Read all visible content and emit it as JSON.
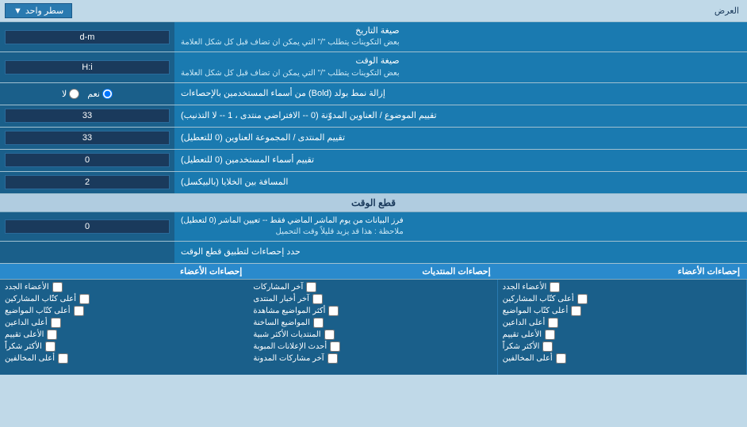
{
  "top": {
    "label": "العرض",
    "dropdown_label": "سطر واحد"
  },
  "rows": [
    {
      "id": "date_format",
      "label": "صيغة التاريخ",
      "sublabel": "بعض التكوينات يتطلب \"/\" التي يمكن ان تضاف قبل كل شكل العلامة",
      "value": "d-m",
      "type": "text"
    },
    {
      "id": "time_format",
      "label": "صيغة الوقت",
      "sublabel": "بعض التكوينات يتطلب \"/\" التي يمكن ان تضاف قبل كل شكل العلامة",
      "value": "H:i",
      "type": "text"
    },
    {
      "id": "bold_names",
      "label": "إزالة نمط بولد (Bold) من أسماء المستخدمين بالإحصاءات",
      "type": "radio",
      "options": [
        "نعم",
        "لا"
      ],
      "selected": "نعم"
    },
    {
      "id": "topic_headings",
      "label": "تقييم الموضوع / العناوين المدوّنة (0 -- الافتراضي منتدى ، 1 -- لا التذنيب)",
      "value": "33",
      "type": "text"
    },
    {
      "id": "forum_headings",
      "label": "تقييم المنتدى / المجموعة العناوين (0 للتعطيل)",
      "value": "33",
      "type": "text"
    },
    {
      "id": "usernames",
      "label": "تقييم أسماء المستخدمين (0 للتعطيل)",
      "value": "0",
      "type": "text"
    },
    {
      "id": "cell_spacing",
      "label": "المسافة بين الخلايا (بالبيكسل)",
      "value": "2",
      "type": "text"
    }
  ],
  "cutoff_section": {
    "title": "قطع الوقت",
    "row": {
      "label": "فرز البيانات من يوم الماشر الماضي فقط -- تعيين الماشر (0 لتعطيل)\nملاحظة : هذا قد يزيد قليلاً وقت التحميل",
      "value": "0"
    },
    "stats_label": "حدد إحصاءات لتطبيق قطع الوقت"
  },
  "stats_columns": [
    {
      "header": "إحصاءات الأعضاء",
      "items": [
        "الأعضاء الجدد",
        "أعلى كتّاب المشاركين",
        "أعلى كتّاب المواضيع",
        "أعلى الداعين",
        "الأعلى تقييم",
        "الأكثر شكراً",
        "أعلى المخالفين"
      ]
    },
    {
      "header": "إحصاءات المنتديات",
      "items": [
        "آخر المشاركات",
        "آخر أخبار المنتدى",
        "أكثر المواضيع مشاهدة",
        "المواضيع الساخنة",
        "المنتديات الأكثر شبية",
        "أحدث الإعلانات المبوبة",
        "آخر مشاركات المدونة"
      ]
    },
    {
      "header": "إحصاءات الأعضاء",
      "items": [
        "الأعضاء الجدد",
        "أعلى كتّاب المشاركين",
        "أعلى كتّاب المواضيع",
        "أعلى الداعين",
        "الأعلى تقييم",
        "الأكثر شكراً",
        "أعلى المخالفين"
      ]
    }
  ]
}
